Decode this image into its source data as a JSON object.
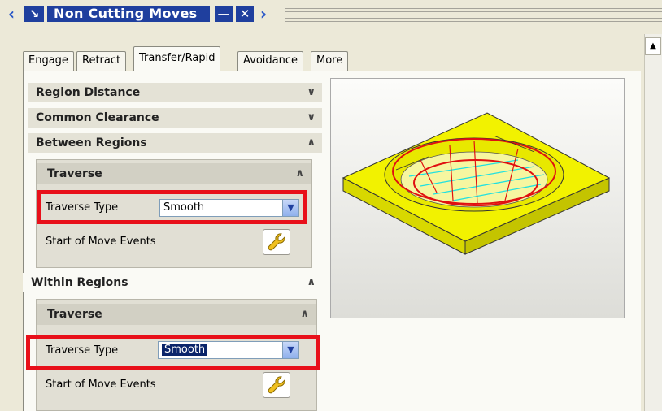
{
  "window": {
    "title": "Non Cutting Moves"
  },
  "tabs": [
    "Engage",
    "Retract",
    "Transfer/Rapid",
    "Avoidance",
    "More"
  ],
  "active_tab": "Transfer/Rapid",
  "sections": {
    "region_distance": "Region Distance",
    "common_clearance": "Common Clearance",
    "between_regions": "Between Regions",
    "within_regions": "Within Regions"
  },
  "between": {
    "group_title": "Traverse",
    "traverse_type_label": "Traverse Type",
    "traverse_type_value": "Smooth",
    "start_events_label": "Start of Move Events"
  },
  "within": {
    "group_title": "Traverse",
    "traverse_type_label": "Traverse Type",
    "traverse_type_value": "Smooth",
    "start_events_label": "Start of Move Events"
  },
  "colors": {
    "title_bg": "#1f3f9e",
    "highlight": "#e8101a",
    "part_yellow": "#f2f200",
    "toolpath_red": "#e01010",
    "toolpath_cyan": "#20e0e0"
  }
}
